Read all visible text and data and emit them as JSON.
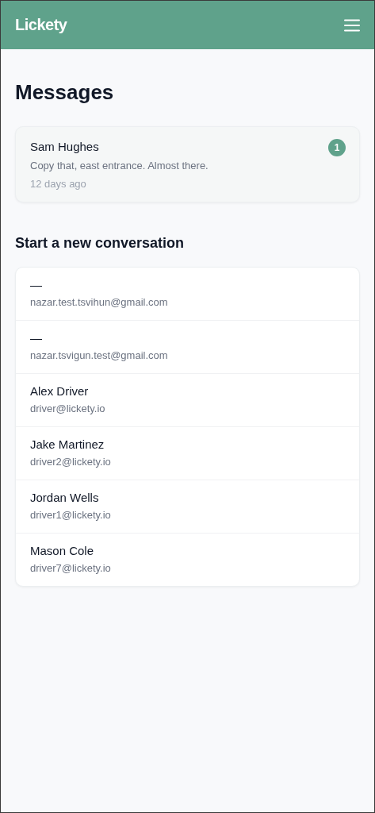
{
  "header": {
    "brand": "Lickety"
  },
  "title": "Messages",
  "conversations": [
    {
      "name": "Sam Hughes",
      "preview": "Copy that, east entrance. Almost there.",
      "time": "12 days ago",
      "unread": "1"
    }
  ],
  "new_conversation": {
    "heading": "Start a new conversation",
    "contacts": [
      {
        "name": "—",
        "email": "nazar.test.tsvihun@gmail.com"
      },
      {
        "name": "—",
        "email": "nazar.tsvigun.test@gmail.com"
      },
      {
        "name": "Alex Driver",
        "email": "driver@lickety.io"
      },
      {
        "name": "Jake Martinez",
        "email": "driver2@lickety.io"
      },
      {
        "name": "Jordan Wells",
        "email": "driver1@lickety.io"
      },
      {
        "name": "Mason Cole",
        "email": "driver7@lickety.io"
      }
    ]
  }
}
